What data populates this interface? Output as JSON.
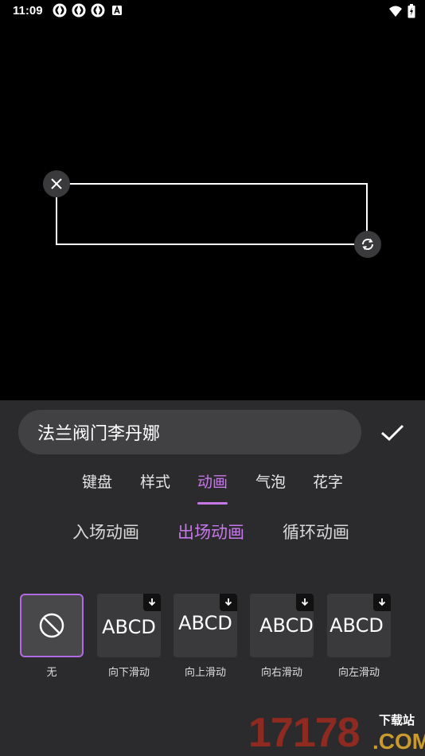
{
  "status_bar": {
    "time": "11:09",
    "icons": [
      "aperture-icon",
      "aperture-icon",
      "aperture-icon",
      "a-badge-icon"
    ],
    "right_icons": [
      "wifi-icon",
      "battery-charging-icon"
    ]
  },
  "editor": {
    "text_value": "法兰阀门李丹娜",
    "confirm_icon": "check-icon"
  },
  "tabs": [
    {
      "label": "键盘",
      "active": false
    },
    {
      "label": "样式",
      "active": false
    },
    {
      "label": "动画",
      "active": true
    },
    {
      "label": "气泡",
      "active": false
    },
    {
      "label": "花字",
      "active": false
    }
  ],
  "subtabs": [
    {
      "label": "入场动画",
      "active": false
    },
    {
      "label": "出场动画",
      "active": true
    },
    {
      "label": "循环动画",
      "active": false
    }
  ],
  "animations": [
    {
      "label": "无",
      "preview": "",
      "selected": true,
      "icon": "no-entry-icon"
    },
    {
      "label": "向下滑动",
      "preview": "ABCD",
      "selected": false,
      "icon": "download-icon"
    },
    {
      "label": "向上滑动",
      "preview": "ABCD",
      "selected": false,
      "icon": "download-icon"
    },
    {
      "label": "向右滑动",
      "preview": "ABCD",
      "selected": false,
      "icon": "download-icon"
    },
    {
      "label": "向左滑动",
      "preview": "ABCD",
      "selected": false,
      "icon": "download-icon"
    }
  ],
  "watermark": {
    "number": "17178",
    "cn": "下载站",
    "com": ".COM"
  },
  "colors": {
    "accent": "#c678e8",
    "panel_bg": "#2b2b2d",
    "canvas_bg": "#000000"
  }
}
